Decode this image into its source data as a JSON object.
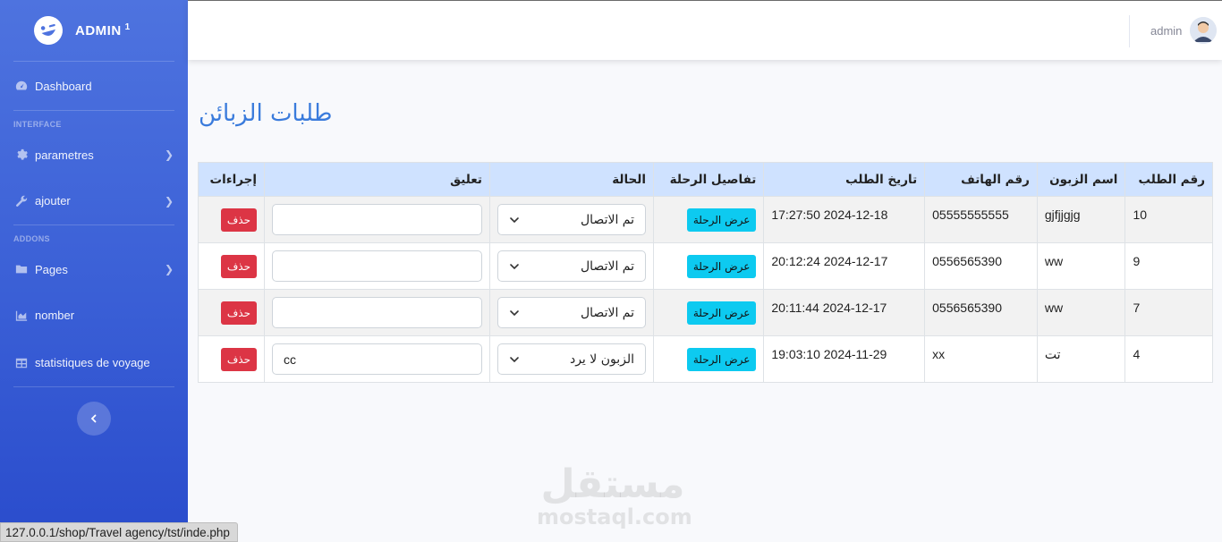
{
  "brand": {
    "name": "ADMIN",
    "sup": "1"
  },
  "sidebar": {
    "dashboard": "Dashboard",
    "heading_interface": "INTERFACE",
    "parametres": "parametres",
    "ajouter": "ajouter",
    "heading_addons": "ADDONS",
    "pages": "Pages",
    "nomber": "nomber",
    "statistiques": "statistiques de voyage"
  },
  "topbar": {
    "user_name": "admin"
  },
  "page": {
    "title": "طلبات الزبائن"
  },
  "table": {
    "headers": {
      "id": "رقم الطلب",
      "name": "اسم الزبون",
      "phone": "رقم الهاتف",
      "date": "تاريخ الطلب",
      "trip": "تفاصيل الرحلة",
      "status": "الحالة",
      "comment": "تعليق",
      "actions": "إجراءات"
    },
    "trip_button": "عرض الرحلة",
    "delete_button": "حذف",
    "rows": [
      {
        "id": "10",
        "name": "gjfjjgjg",
        "phone": "05555555555",
        "date": "2024-12-18 17:27:50",
        "status": "تم الاتصال",
        "comment": ""
      },
      {
        "id": "9",
        "name": "ww",
        "phone": "0556565390",
        "date": "2024-12-17 20:12:24",
        "status": "تم الاتصال",
        "comment": ""
      },
      {
        "id": "7",
        "name": "ww",
        "phone": "0556565390",
        "date": "2024-12-17 20:11:44",
        "status": "تم الاتصال",
        "comment": ""
      },
      {
        "id": "4",
        "name": "تت",
        "phone": "xx",
        "date": "2024-11-29 19:03:10",
        "status": "الزبون لا يرد",
        "comment": "cc"
      }
    ]
  },
  "watermark": {
    "arabic": "مستقل",
    "latin": "mostaql.com"
  },
  "statusbar": {
    "url": "127.0.0.1/shop/Travel agency/tst/inde.php"
  },
  "colors": {
    "sidebar": "#4e73df",
    "title": "#3a7bdc",
    "header_bg": "#cfe2ff",
    "info": "#0dcaf0",
    "danger": "#dc3545"
  }
}
